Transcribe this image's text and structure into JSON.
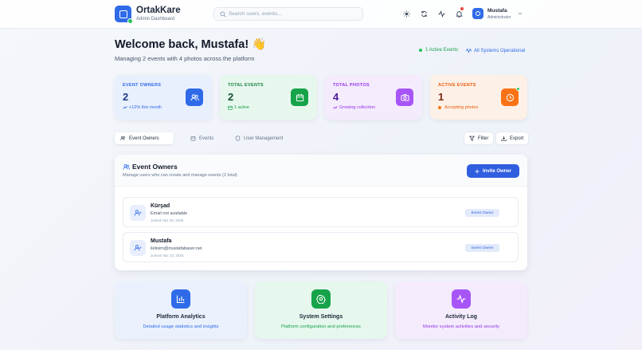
{
  "header": {
    "brand": "OrtakKare",
    "brand_sub": "Admin Dashboard",
    "search_placeholder": "Search users, events...",
    "user_name": "Mustafa",
    "user_role": "Administrator"
  },
  "welcome": {
    "title": "Welcome back, Mustafa! 👋",
    "subtitle": "Managing 2 events with 4 photos across the platform",
    "active_events": "1 Active Events",
    "system_status": "All Systems Operational"
  },
  "stats": [
    {
      "label": "EVENT OWNERS",
      "value": "2",
      "foot": "+12% this month",
      "color": "#2f6be8",
      "bg": "#e9f0fd",
      "icon": "users-icon"
    },
    {
      "label": "TOTAL EVENTS",
      "value": "2",
      "foot": "1 active",
      "color": "#16a34a",
      "bg": "#e7f7ee",
      "icon": "calendar-icon"
    },
    {
      "label": "TOTAL PHOTOS",
      "value": "4",
      "foot": "Growing collection",
      "color": "#9333ea",
      "bg": "#f4ecfd",
      "icon": "camera-icon"
    },
    {
      "label": "ACTIVE EVENTS",
      "value": "1",
      "foot": "Accepting photos",
      "color": "#ea580c",
      "bg": "#fdf0e6",
      "icon": "clock-icon"
    }
  ],
  "tabs": [
    "Event Owners",
    "Events",
    "User Management"
  ],
  "actions": {
    "filter": "Filter",
    "export": "Export"
  },
  "panel": {
    "title": "Event Owners",
    "subtitle": "Manage users who can create and manage events (2 total)",
    "invite": "Invite Owner",
    "owners": [
      {
        "name": "Kürşad",
        "email": "Email not available",
        "joined": "Joined Haz 29, 2025",
        "badge": "Event Owner"
      },
      {
        "name": "Mustafa",
        "email": "iletisim@mustafabaser.net",
        "joined": "Joined Haz 13, 2025",
        "badge": "Event Owner"
      }
    ]
  },
  "bottom_cards": [
    {
      "title": "Platform Analytics",
      "subtitle": "Detailed usage statistics and insights",
      "color": "#2f6be8",
      "icon": "bar-chart-icon"
    },
    {
      "title": "System Settings",
      "subtitle": "Platform configuration and preferences",
      "color": "#16a34a",
      "icon": "settings-icon"
    },
    {
      "title": "Activity Log",
      "subtitle": "Monitor system activities and security",
      "color": "#9333ea",
      "icon": "activity-icon"
    }
  ]
}
